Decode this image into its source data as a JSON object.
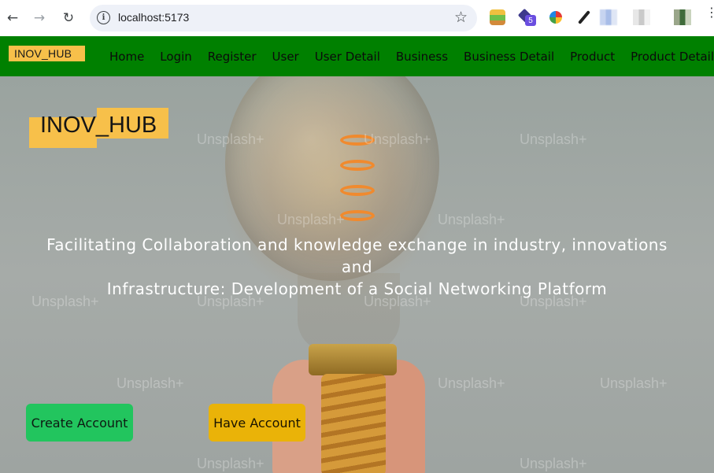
{
  "browser": {
    "url": "localhost:5173",
    "extension_badge": "5",
    "icons": [
      "back-icon",
      "forward-icon",
      "reload-icon",
      "site-info-icon",
      "bookmark-star-icon",
      "menu-icon"
    ]
  },
  "navbar": {
    "brand": "INOV_HUB",
    "links": [
      "Home",
      "Login",
      "Register",
      "User",
      "User Detail",
      "Business",
      "Business Detail",
      "Product",
      "Product Detail"
    ],
    "bg_color": "#008000",
    "brand_highlight": "#f7c04a"
  },
  "hero": {
    "brand": "INOV_HUB",
    "tagline_line1": "Facilitating Collaboration and knowledge exchange in industry, innovations and",
    "tagline_line2": "Infrastructure: Development of a Social Networking Platform",
    "watermark": "Unsplash+",
    "buttons": {
      "create": "Create Account",
      "have": "Have Account"
    },
    "colors": {
      "create_button": "#22c55e",
      "have_button": "#eab308"
    }
  }
}
